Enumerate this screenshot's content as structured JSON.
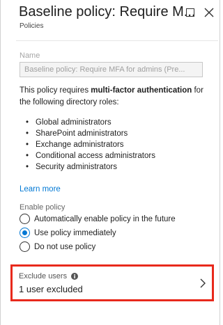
{
  "header": {
    "title": "Baseline policy: Require M...",
    "subtitle": "Policies",
    "maximize_icon": "maximize-icon",
    "close_icon": "close-icon"
  },
  "form": {
    "name_label": "Name",
    "name_value": "Baseline policy: Require MFA for admins (Pre...",
    "description_prefix": "This policy requires ",
    "description_bold": "multi-factor authentication",
    "description_suffix": " for the following directory roles:",
    "roles": [
      "Global administrators",
      "SharePoint administrators",
      "Exchange administrators",
      "Conditional access administrators",
      "Security administrators"
    ],
    "learn_more": "Learn more",
    "enable_policy_label": "Enable policy",
    "enable_options": [
      {
        "label": "Automatically enable policy in the future",
        "selected": false
      },
      {
        "label": "Use policy immediately",
        "selected": true
      },
      {
        "label": "Do not use policy",
        "selected": false
      }
    ],
    "exclude_users_label": "Exclude users",
    "exclude_users_value": "1 user excluded"
  },
  "colors": {
    "accent": "#0078d4",
    "highlight_border": "#e8291c"
  }
}
